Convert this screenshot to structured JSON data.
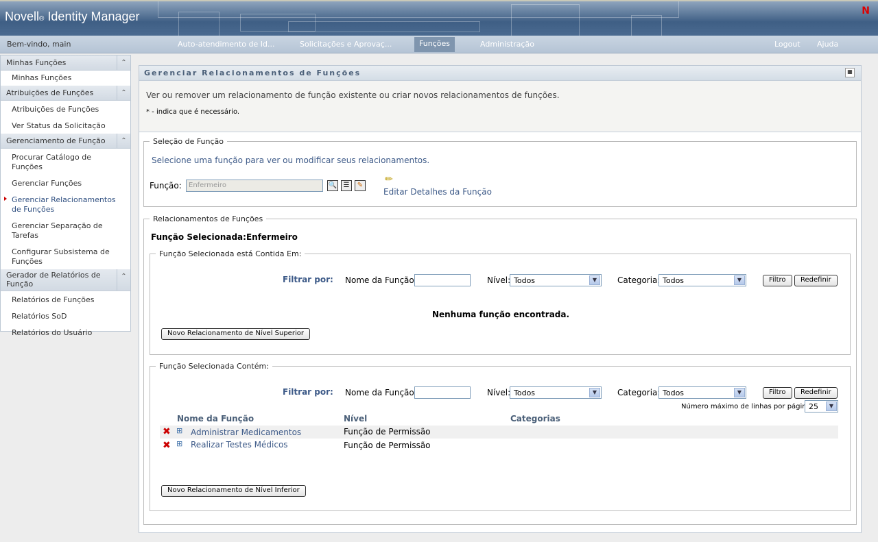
{
  "header": {
    "brand": "Novell",
    "reg": "®",
    "product": "Identity Manager",
    "corner_logo": "N"
  },
  "nav": {
    "welcome": "Bem-vindo, main",
    "tabs": [
      "Auto-atendimento de Id...",
      "Solicitações e Aprovaç...",
      "Funções",
      "Administração"
    ],
    "logout": "Logout",
    "help": "Ajuda"
  },
  "sidebar": {
    "sections": [
      {
        "title": "Minhas Funções",
        "items": [
          "Minhas Funções"
        ]
      },
      {
        "title": "Atribuições de Funções",
        "items": [
          "Atribuições de Funções",
          "Ver Status da Solicitação"
        ]
      },
      {
        "title": "Gerenciamento de Função",
        "items": [
          "Procurar Catálogo de Funções",
          "Gerenciar Funções",
          "Gerenciar Relacionamentos de Funções",
          "Gerenciar Separação de Tarefas",
          "Configurar Subsistema de Funções"
        ]
      },
      {
        "title": "Gerador de Relatórios de Função",
        "items": [
          "Relatórios de Funções",
          "Relatórios SoD",
          "Relatórios do Usuário"
        ]
      }
    ]
  },
  "page": {
    "title": "Gerenciar Relacionamentos de Funções",
    "description": "Ver ou remover um relacionamento de função existente ou criar novos relacionamentos de funções.",
    "required_note": "* - indica que é necessário.",
    "selection": {
      "legend": "Seleção de Função",
      "hint": "Selecione uma função para ver ou modificar seus relacionamentos.",
      "label": "Função:",
      "value": "Enfermeiro",
      "edit_link": "Editar Detalhes da Função"
    },
    "relationships": {
      "legend": "Relacionamentos de Funções",
      "selected": "Função Selecionada:Enfermeiro",
      "filter": {
        "by": "Filtrar por:",
        "name_label": "Nome da Função:",
        "level_label": "Nível:",
        "level_value": "Todos",
        "category_label": "Categoria:",
        "category_value": "Todos",
        "filter_btn": "Filtro",
        "reset_btn": "Redefinir"
      },
      "contained_in": {
        "legend": "Função Selecionada está Contida Em:",
        "empty": "Nenhuma função encontrada.",
        "new_btn": "Novo Relacionamento de Nível Superior"
      },
      "contains": {
        "legend": "Função Selecionada Contém:",
        "max_rows_label": "Número máximo de linhas por página",
        "max_rows": "25",
        "columns": [
          "Nome da Função",
          "Nível",
          "Categorias"
        ],
        "rows": [
          {
            "name": "Administrar Medicamentos",
            "level": "Função de Permissão"
          },
          {
            "name": "Realizar Testes Médicos",
            "level": "Função de Permissão"
          }
        ],
        "new_btn": "Novo Relacionamento de Nível Inferior"
      }
    }
  }
}
